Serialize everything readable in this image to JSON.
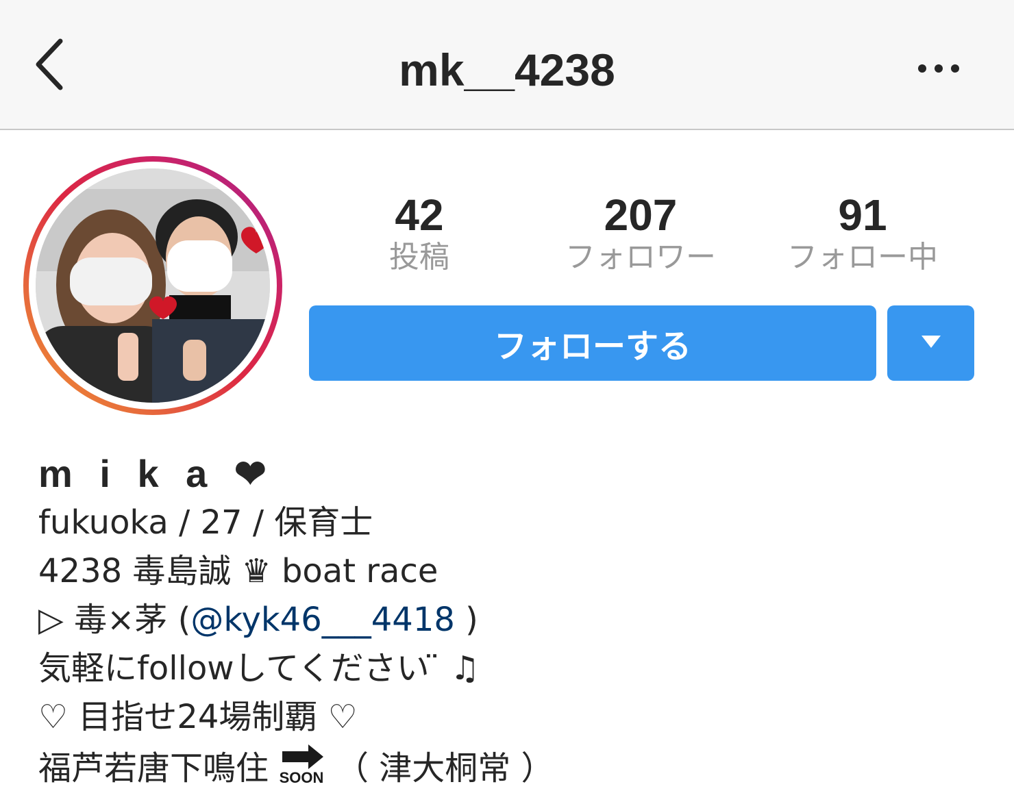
{
  "header": {
    "back_icon": "chevron-left-icon",
    "title": "mk__4238",
    "more_icon": "more-horizontal-icon"
  },
  "profile": {
    "avatar_alt": "profile photo",
    "stats": [
      {
        "count": "42",
        "label": "投稿"
      },
      {
        "count": "207",
        "label": "フォロワー"
      },
      {
        "count": "91",
        "label": "フォロー中"
      }
    ],
    "follow_label": "フォローする",
    "dropdown_icon": "caret-down-icon"
  },
  "bio": {
    "name": "m i k a ❤",
    "line1": "fukuoka / 27 / 保育士",
    "line2": "4238 毒島誠 ♛ boat race",
    "line3_prefix": "▷ 毒×茅 (",
    "line3_mention": "@kyk46___4418",
    "line3_suffix": " )",
    "line4": "気軽にfollowしてください ̈ ♫",
    "line5": "♡ 目指せ24場制覇 ♡",
    "line6_prefix": "福芦若唐下鳴住",
    "line6_badge": "SOON",
    "line6_suffix": "（ 津大桐常 ）"
  },
  "colors": {
    "accent": "#3897f0",
    "link": "#003569",
    "muted": "#999999"
  }
}
